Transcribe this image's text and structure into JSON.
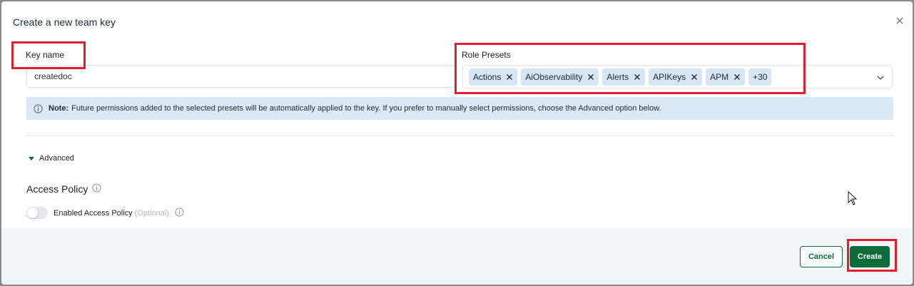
{
  "dialog": {
    "title": "Create a new team key",
    "close_icon": "close-icon"
  },
  "form": {
    "key_name_label": "Key name",
    "key_name_value": "createdoc",
    "role_presets_label": "Role Presets",
    "presets": [
      {
        "label": "Actions"
      },
      {
        "label": "AiObservability"
      },
      {
        "label": "Alerts"
      },
      {
        "label": "APIKeys"
      },
      {
        "label": "APM"
      }
    ],
    "presets_more": "+30",
    "dropdown_icon": "chevron-down-icon"
  },
  "note": {
    "icon": "info-icon",
    "bold": "Note:",
    "text": "Future permissions added to the selected presets will be automatically applied to the key. If you prefer to manually select permissions, choose the Advanced option below."
  },
  "advanced": {
    "label": "Advanced"
  },
  "access_policy": {
    "heading": "Access Policy",
    "toggle_label": "Enabled Access Policy",
    "optional": "(Optional)",
    "toggle_on": false
  },
  "footer": {
    "cancel_label": "Cancel",
    "create_label": "Create"
  },
  "colors": {
    "primary": "#0b6b3a",
    "chip_bg": "#d7e6f5",
    "note_bg": "#dbe9f7",
    "highlight": "#e11d2e"
  }
}
